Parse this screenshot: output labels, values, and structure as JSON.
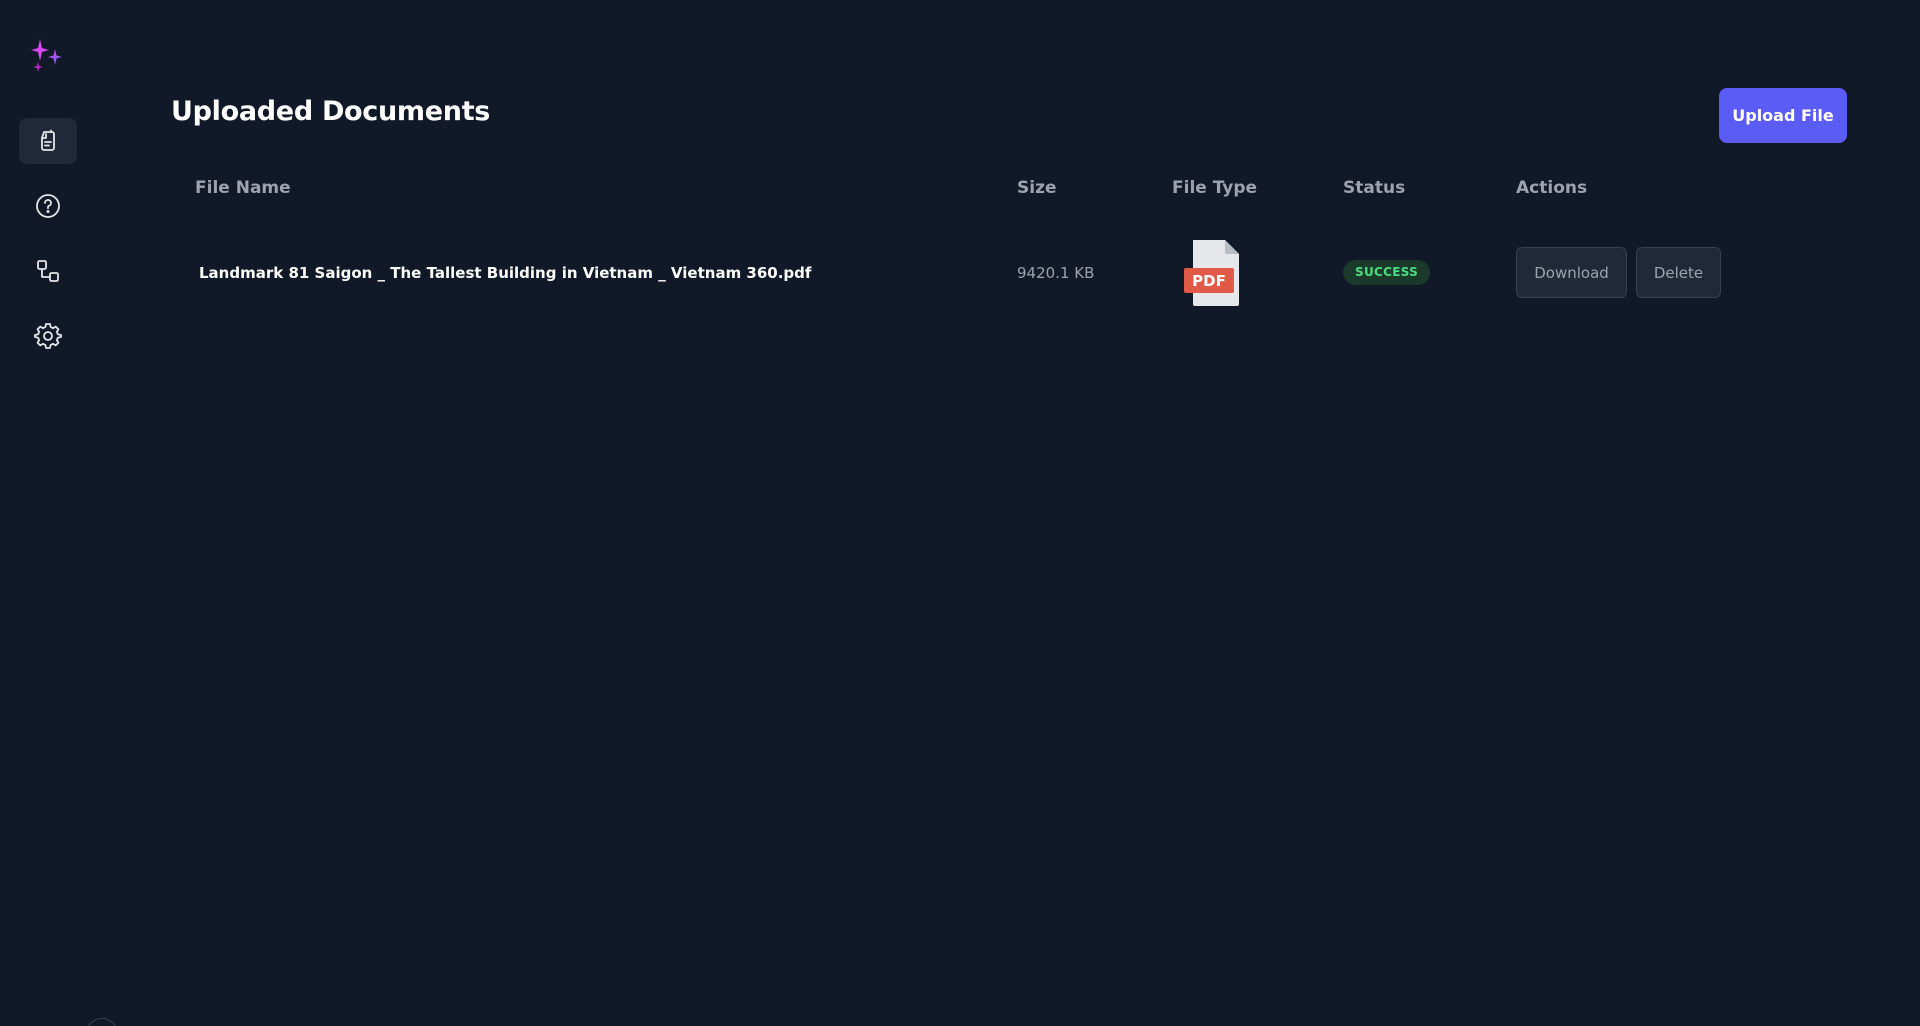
{
  "header": {
    "title": "Uploaded Documents",
    "upload_label": "Upload File"
  },
  "sidebar": {
    "items": [
      {
        "name": "documents",
        "icon": "document-icon",
        "active": true
      },
      {
        "name": "help",
        "icon": "help-circle-icon",
        "active": false
      },
      {
        "name": "workflow",
        "icon": "workflow-icon",
        "active": false
      },
      {
        "name": "settings",
        "icon": "gear-icon",
        "active": false
      }
    ]
  },
  "table": {
    "columns": [
      "File Name",
      "Size",
      "File Type",
      "Status",
      "Actions"
    ],
    "rows": [
      {
        "file_name": "Landmark 81 Saigon _ The Tallest Building in Vietnam _ Vietnam 360.pdf",
        "size": "9420.1 KB",
        "file_type_icon": "pdf-file-icon",
        "file_type_label": "PDF",
        "status": "SUCCESS",
        "actions": {
          "download_label": "Download",
          "delete_label": "Delete"
        }
      }
    ]
  },
  "colors": {
    "background": "#111827",
    "accent": "#5b5cf6",
    "success": "#4ade80",
    "pdf_red": "#e05a47"
  }
}
